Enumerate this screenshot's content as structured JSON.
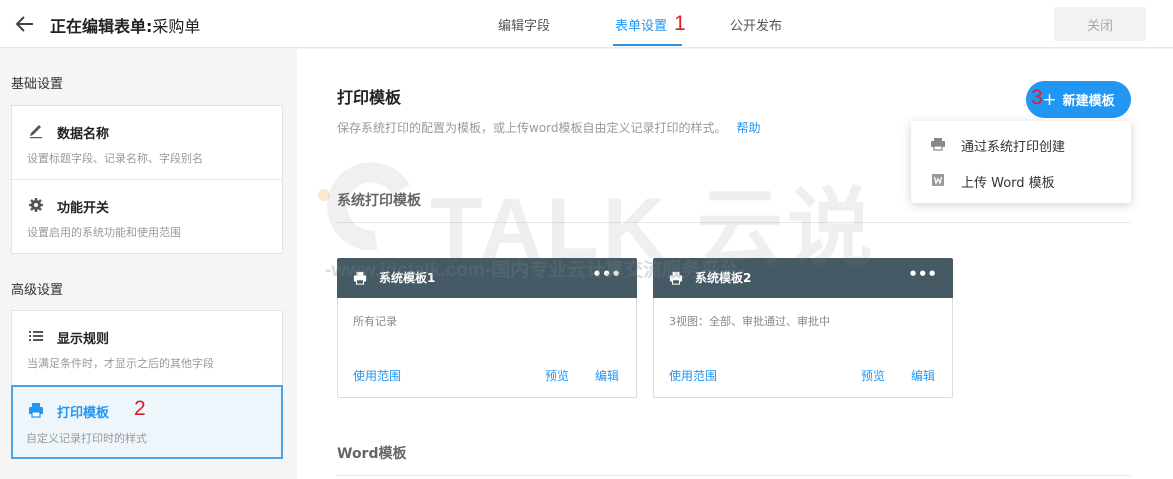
{
  "header": {
    "title_prefix": "正在编辑表单:",
    "title_name": "采购单",
    "tabs": [
      {
        "label": "编辑字段"
      },
      {
        "label": "表单设置"
      },
      {
        "label": "公开发布"
      }
    ],
    "close_label": "关闭"
  },
  "annotations": [
    "1",
    "2",
    "3"
  ],
  "sidebar": {
    "basic_title": "基础设置",
    "basic_items": [
      {
        "label": "数据名称",
        "desc": "设置标题字段、记录名称、字段别名",
        "icon": "pencil-icon"
      },
      {
        "label": "功能开关",
        "desc": "设置启用的系统功能和使用范围",
        "icon": "gear-icon"
      }
    ],
    "advanced_title": "高级设置",
    "advanced_items": [
      {
        "label": "显示规则",
        "desc": "当满足条件时，才显示之后的其他字段",
        "icon": "list-icon"
      },
      {
        "label": "打印模板",
        "desc": "自定义记录打印时的样式",
        "icon": "printer-icon"
      }
    ]
  },
  "main": {
    "title": "打印模板",
    "desc": "保存系统打印的配置为模板，或上传word模板自由定义记录打印的样式。",
    "help": "帮助",
    "new_button": "新建模板",
    "dropdown": [
      {
        "label": "通过系统打印创建",
        "icon": "printer-icon"
      },
      {
        "label": "上传 Word 模板",
        "icon": "word-file-icon"
      }
    ],
    "system_section": "系统打印模板",
    "templates": [
      {
        "name": "系统模板1",
        "desc": "所有记录",
        "scope": "使用范围",
        "preview": "预览",
        "edit": "编辑"
      },
      {
        "name": "系统模板2",
        "desc": "3视图：全部、审批通过、审批中",
        "scope": "使用范围",
        "preview": "预览",
        "edit": "编辑"
      }
    ],
    "more": "•••",
    "word_section": "Word模板"
  },
  "watermark": {
    "brand": "TALK 云说",
    "url": "-www.idctalk.com-国内专业云计算交流服务平台-"
  },
  "colors": {
    "accent": "#2196f3",
    "card_header": "#455a64",
    "annotation": "#e02020"
  }
}
